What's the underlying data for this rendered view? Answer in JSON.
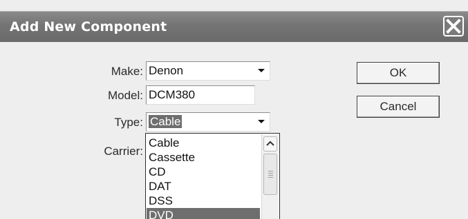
{
  "window": {
    "title": "Add New Component"
  },
  "form": {
    "make": {
      "label": "Make:",
      "value": "Denon"
    },
    "model": {
      "label": "Model:",
      "value": "DCM380"
    },
    "type": {
      "label": "Type:",
      "value": "Cable"
    },
    "carrier": {
      "label": "Carrier:"
    }
  },
  "buttons": {
    "ok": "OK",
    "cancel": "Cancel"
  },
  "type_list": {
    "items": [
      "Cable",
      "Cassette",
      "CD",
      "DAT",
      "DSS",
      "DVD"
    ],
    "highlighted": "DVD"
  },
  "icons": {
    "close": "close-icon",
    "dropdown": "chevron-down-icon",
    "scroll_up": "chevron-up-icon"
  },
  "colors": {
    "titlebar": "#747474",
    "selection": "#6e6e6e"
  }
}
